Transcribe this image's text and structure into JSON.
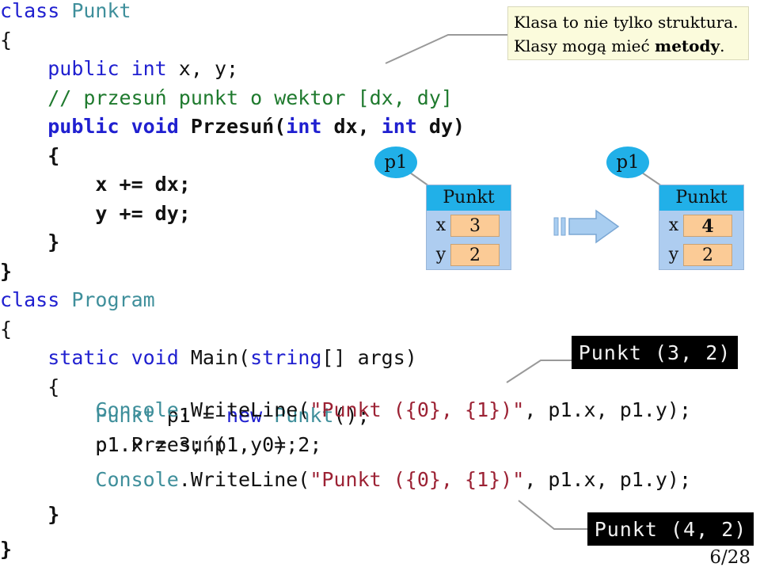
{
  "slide": {
    "page_number": "6/28"
  },
  "callout": {
    "line1": "Klasa to nie tylko struktura.",
    "line2_prefix": "Klasy mogą mieć ",
    "line2_bold": "metody",
    "line2_suffix": "."
  },
  "code_top": {
    "lines": [
      [
        {
          "t": "class ",
          "c": "kw"
        },
        {
          "t": "Punkt",
          "c": "typ"
        }
      ],
      [
        {
          "t": "{",
          "c": "pln"
        }
      ],
      [
        {
          "t": "    ",
          "c": "pln"
        },
        {
          "t": "public int",
          "c": "kw"
        },
        {
          "t": " x, y;",
          "c": "pln"
        }
      ],
      [
        {
          "t": "    ",
          "c": "pln"
        },
        {
          "t": "// przesuń punkt o wektor [dx, dy]",
          "c": "cmt"
        }
      ],
      [
        {
          "t": "    ",
          "c": "pln"
        },
        {
          "t": "public void ",
          "c": "kwb"
        },
        {
          "t": "Przesuń(",
          "c": "plnb"
        },
        {
          "t": "int",
          "c": "kwb"
        },
        {
          "t": " dx, ",
          "c": "plnb"
        },
        {
          "t": "int",
          "c": "kwb"
        },
        {
          "t": " dy)",
          "c": "plnb"
        }
      ],
      [
        {
          "t": "    ",
          "c": "pln"
        },
        {
          "t": "{",
          "c": "plnb"
        }
      ],
      [
        {
          "t": "        ",
          "c": "pln"
        },
        {
          "t": "x += dx;",
          "c": "plnb"
        }
      ],
      [
        {
          "t": "        ",
          "c": "pln"
        },
        {
          "t": "y += dy;",
          "c": "plnb"
        }
      ],
      [
        {
          "t": "    ",
          "c": "pln"
        },
        {
          "t": "}",
          "c": "plnb"
        }
      ],
      [
        {
          "t": "}",
          "c": "plnb"
        }
      ],
      [
        {
          "t": "class ",
          "c": "kw"
        },
        {
          "t": "Program",
          "c": "typ"
        }
      ],
      [
        {
          "t": "{",
          "c": "pln"
        }
      ],
      [
        {
          "t": "    ",
          "c": "pln"
        },
        {
          "t": "static void ",
          "c": "kw"
        },
        {
          "t": "Main(",
          "c": "pln"
        },
        {
          "t": "string",
          "c": "kw"
        },
        {
          "t": "[] args)",
          "c": "pln"
        }
      ],
      [
        {
          "t": "    ",
          "c": "pln"
        },
        {
          "t": "{",
          "c": "pln"
        }
      ],
      [
        {
          "t": "        ",
          "c": "pln"
        },
        {
          "t": "Punkt",
          "c": "typ"
        },
        {
          "t": " p1 = ",
          "c": "pln"
        },
        {
          "t": "new",
          "c": "kw"
        },
        {
          "t": " ",
          "c": "pln"
        },
        {
          "t": "Punkt",
          "c": "typ"
        },
        {
          "t": "();",
          "c": "pln"
        }
      ],
      [
        {
          "t": "        p1.x = 3; p1.y = 2;",
          "c": "pln"
        }
      ]
    ]
  },
  "code_bottom": {
    "lines": [
      [
        {
          "t": "        ",
          "c": "pln"
        },
        {
          "t": "Console",
          "c": "typ"
        },
        {
          "t": ".WriteLine(",
          "c": "pln"
        },
        {
          "t": "\"Punkt ({0}, {1})\"",
          "c": "str"
        },
        {
          "t": ", p1.x, p1.y);",
          "c": "pln"
        }
      ],
      [
        {
          "t": "        p1.Przesuń(1, 0);",
          "c": "pln"
        }
      ],
      [
        {
          "t": "        ",
          "c": "pln"
        },
        {
          "t": "Console",
          "c": "typ"
        },
        {
          "t": ".WriteLine(",
          "c": "pln"
        },
        {
          "t": "\"Punkt ({0}, {1})\"",
          "c": "str"
        },
        {
          "t": ", p1.x, p1.y);",
          "c": "pln"
        }
      ],
      [
        {
          "t": "    ",
          "c": "pln"
        },
        {
          "t": "}",
          "c": "plnb"
        }
      ],
      [
        {
          "t": "}",
          "c": "plnb"
        }
      ]
    ]
  },
  "diagram_before": {
    "ref_label": "p1",
    "class_name": "Punkt",
    "fields": [
      {
        "name": "x",
        "value": "3",
        "changed": false
      },
      {
        "name": "y",
        "value": "2",
        "changed": false
      }
    ]
  },
  "diagram_after": {
    "ref_label": "p1",
    "class_name": "Punkt",
    "fields": [
      {
        "name": "x",
        "value": "4",
        "changed": true
      },
      {
        "name": "y",
        "value": "2",
        "changed": false
      }
    ]
  },
  "console_outputs": [
    {
      "text": "Punkt (3, 2)"
    },
    {
      "text": "Punkt (4, 2)"
    }
  ],
  "colors": {
    "header_cyan": "#21b0e8",
    "body_blue": "#aecdf0",
    "value_orange": "#fbcb96",
    "callout_yellow": "#fbfbdc",
    "arrow_blue": "#a8cdf0",
    "leader_gray": "#999999",
    "console_bg": "#000000"
  }
}
